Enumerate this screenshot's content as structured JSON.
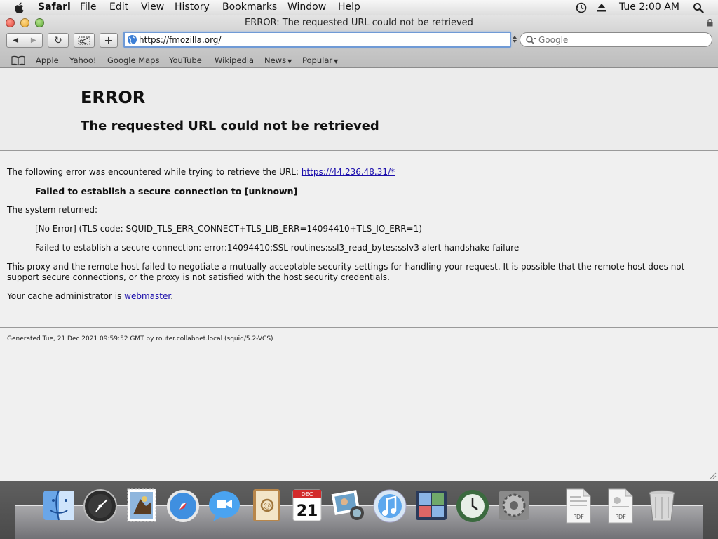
{
  "menubar": {
    "app_name": "Safari",
    "items": [
      "File",
      "Edit",
      "View",
      "History",
      "Bookmarks",
      "Window",
      "Help"
    ],
    "clock": "Tue 2:00 AM",
    "icons": [
      "apple-icon",
      "time-machine-icon",
      "eject-icon",
      "spotlight-icon"
    ]
  },
  "window": {
    "title": "ERROR: The requested URL could not be retrieved"
  },
  "toolbar": {
    "back_label": "◀",
    "forward_label": "▶",
    "reload_label": "↻",
    "add_label": "+",
    "url": "https://fmozilla.org/",
    "search_placeholder": "Google"
  },
  "bookmarks": {
    "items": [
      "Apple",
      "Yahoo!",
      "Google Maps",
      "YouTube",
      "Wikipedia",
      "News",
      "Popular"
    ]
  },
  "page": {
    "title": "ERROR",
    "subtitle": "The requested URL could not be retrieved",
    "intro": "The following error was encountered while trying to retrieve the URL: ",
    "failed_url": "https://44.236.48.31/*",
    "failed_message": "Failed to establish a secure connection to [unknown]",
    "system_returned": "The system returned:",
    "tls_code": "[No Error] (TLS code: SQUID_TLS_ERR_CONNECT+TLS_LIB_ERR=14094410+TLS_IO_ERR=1)",
    "ssl_error": "Failed to establish a secure connection: error:14094410:SSL routines:ssl3_read_bytes:sslv3 alert handshake failure",
    "explanation": "This proxy and the remote host failed to negotiate a mutually acceptable security settings for handling your request. It is possible that the remote host does not support secure connections, or the proxy is not satisfied with the host security credentials.",
    "admin_prefix": "Your cache administrator is ",
    "admin_link": "webmaster",
    "admin_suffix": ".",
    "footer": "Generated Tue, 21 Dec 2021 09:59:52 GMT by router.collabnet.local (squid/5.2-VCS)"
  },
  "dock": {
    "calendar_month": "DEC",
    "calendar_day": "21",
    "pdf_label": "PDF"
  }
}
